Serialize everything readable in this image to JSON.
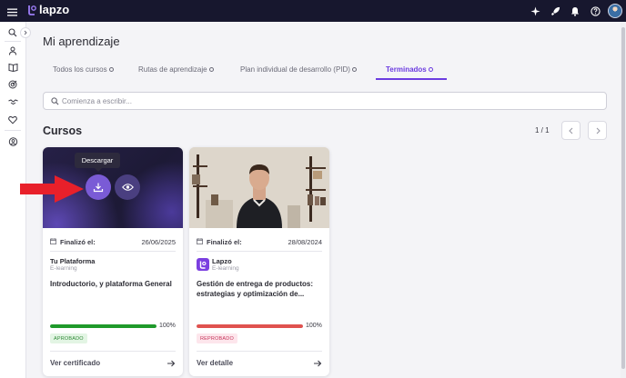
{
  "app": {
    "logo_text": "lapzo"
  },
  "page": {
    "title": "Mi aprendizaje"
  },
  "tabs": [
    {
      "label": "Todos los cursos",
      "active": false
    },
    {
      "label": "Rutas de aprendizaje",
      "active": false
    },
    {
      "label": "Plan individual de desarrollo (PID)",
      "active": false
    },
    {
      "label": "Terminados",
      "active": true
    }
  ],
  "search": {
    "placeholder": "Comienza a escribir...",
    "value": ""
  },
  "courses_section": {
    "title": "Cursos",
    "pagination": "1 / 1"
  },
  "cards": [
    {
      "tooltip": "Descargar",
      "finished_label": "Finalizó el:",
      "finished_date": "26/06/2025",
      "provider": "Tu Plataforma",
      "provider_type": "E-learning",
      "title": "Introductorio, y plataforma General",
      "progress_value": 1.0,
      "progress_label": "100%",
      "status": "APROBADO",
      "status_color": "#2f8a37",
      "progress_color": "#1f9a2b",
      "action": "Ver certificado"
    },
    {
      "finished_label": "Finalizó el:",
      "finished_date": "28/08/2024",
      "provider": "Lapzo",
      "provider_type": "E-learning",
      "title": "Gestión de entrega de productos: estrategias y optimización de...",
      "progress_value": 1.0,
      "progress_label": "100%",
      "status": "REPROBADO",
      "status_color": "#c5345a",
      "progress_color": "#e0524f",
      "action": "Ver detalle"
    }
  ],
  "colors": {
    "accent": "#6c3ce0",
    "topbar": "#17172e",
    "annotation_arrow": "#e8202a"
  },
  "icons": [
    "menu-icon",
    "sparkle-icon",
    "rocket-icon",
    "bell-icon",
    "help-icon",
    "search-icon",
    "user-icon",
    "book-icon",
    "target-icon",
    "handshake-icon",
    "heart-icon",
    "group-icon",
    "download-icon",
    "eye-icon",
    "calendar-icon",
    "arrow-right-icon"
  ]
}
